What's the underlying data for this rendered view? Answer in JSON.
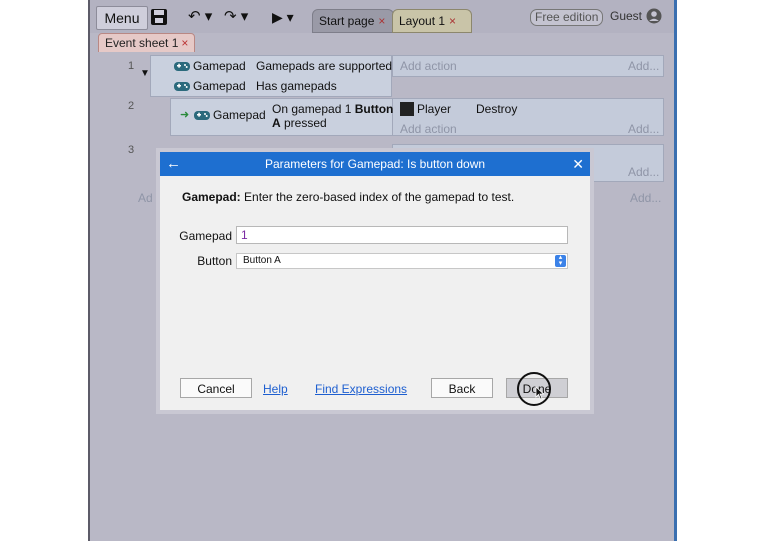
{
  "toolbar": {
    "menu_label": "Menu",
    "save_icon": "save-icon",
    "undo_icon": "undo-icon",
    "redo_icon": "redo-icon",
    "play_icon": "play-icon",
    "tabs": [
      {
        "label": "Start page",
        "close": "×"
      },
      {
        "label": "Layout 1",
        "close": "×"
      }
    ],
    "free_edition": "Free edition",
    "guest": "Guest"
  },
  "sheet_tab": {
    "label": "Event sheet 1",
    "close": "×"
  },
  "events": [
    {
      "number": "1",
      "conditions": [
        {
          "object": "Gamepad",
          "text": "Gamepads are supported"
        },
        {
          "object": "Gamepad",
          "text": "Has gamepads"
        }
      ],
      "add_action": "Add action",
      "add_more": "Add..."
    },
    {
      "number": "2",
      "conditions": [
        {
          "object": "Gamepad",
          "text_line1": "On gamepad 1 ",
          "text_bold": "Button",
          "text_line2_bold": "A",
          "text_line2": " pressed"
        }
      ],
      "actions": [
        {
          "object": "Player",
          "action": "Destroy"
        }
      ],
      "add_action": "Add action",
      "add_more": "Add..."
    },
    {
      "number": "3",
      "add_more": "Add..."
    }
  ],
  "add_partial": "Ad",
  "add_right_outer": "Add...",
  "dialog": {
    "title": "Parameters for Gamepad: Is button down",
    "back_icon": "back-arrow-icon",
    "close_icon": "close-icon",
    "desc_bold": "Gamepad:",
    "desc_text": " Enter the zero-based index of the gamepad to test.",
    "gamepad_label": "Gamepad",
    "gamepad_value": "1",
    "button_label": "Button",
    "button_value": "Button A",
    "cancel": "Cancel",
    "help": "Help",
    "find_expressions": "Find Expressions",
    "back": "Back",
    "done": "Done"
  },
  "colors": {
    "title_bar": "#1e6fd0",
    "link": "#1e5fd0",
    "app_bg": "#b9b8c6",
    "event_bg": "#c9d0de"
  }
}
